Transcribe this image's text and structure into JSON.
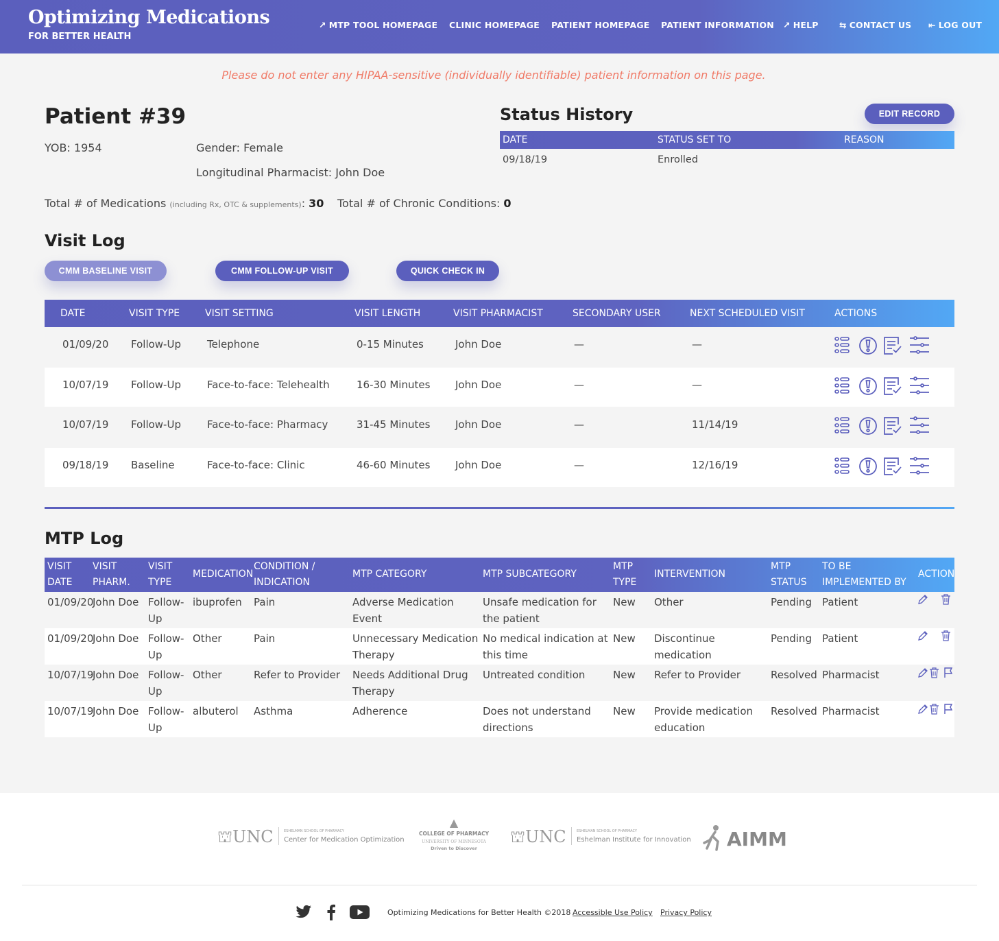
{
  "header": {
    "title": "Optimizing Medications",
    "subtitle": "FOR BETTER HEALTH",
    "nav": [
      {
        "label": "MTP TOOL HOMEPAGE",
        "icon": "arrow-up-right-icon"
      },
      {
        "label": "CLINIC HOMEPAGE"
      },
      {
        "label": "PATIENT HOMEPAGE"
      },
      {
        "label": "PATIENT INFORMATION"
      },
      {
        "label": "HELP",
        "icon": "arrow-up-right-icon"
      },
      {
        "label": "CONTACT US",
        "icon": "swap-arrows-icon"
      },
      {
        "label": "LOG OUT",
        "icon": "logout-icon"
      }
    ]
  },
  "notice": "Please do not enter any HIPAA-sensitive (individually identifiable) patient information on this page.",
  "patient": {
    "title": "Patient #39",
    "yob": "YOB: 1954",
    "gender": "Gender: Female",
    "pharmacist": "Longitudinal Pharmacist: John Doe",
    "meds_label": "Total # of Medications",
    "meds_note": "(including Rx, OTC & supplements)",
    "meds_colon": ":",
    "meds_value": "30",
    "cond_label": "Total # of Chronic Conditions:",
    "cond_value": "0"
  },
  "status_history": {
    "title": "Status History",
    "edit_label": "EDIT RECORD",
    "headers": [
      "DATE",
      "STATUS SET TO",
      "REASON"
    ],
    "rows": [
      {
        "date": "09/18/19",
        "status": "Enrolled",
        "reason": ""
      }
    ]
  },
  "visit_log": {
    "title": "Visit Log",
    "buttons": [
      "CMM BASELINE VISIT",
      "CMM FOLLOW-UP VISIT",
      "QUICK CHECK IN"
    ],
    "headers": [
      "DATE",
      "VISIT TYPE",
      "VISIT SETTING",
      "VISIT LENGTH",
      "VISIT PHARMACIST",
      "SECONDARY USER",
      "NEXT SCHEDULED VISIT",
      "ACTIONS"
    ],
    "rows": [
      {
        "date": "01/09/20",
        "type": "Follow-Up",
        "setting": "Telephone",
        "length": "0-15 Minutes",
        "pharmacist": "John Doe",
        "secondary": "—",
        "next": "—"
      },
      {
        "date": "10/07/19",
        "type": "Follow-Up",
        "setting": "Face-to-face: Telehealth",
        "length": "16-30 Minutes",
        "pharmacist": "John Doe",
        "secondary": "—",
        "next": "—"
      },
      {
        "date": "10/07/19",
        "type": "Follow-Up",
        "setting": "Face-to-face: Pharmacy",
        "length": "31-45 Minutes",
        "pharmacist": "John Doe",
        "secondary": "—",
        "next": "11/14/19"
      },
      {
        "date": "09/18/19",
        "type": "Baseline",
        "setting": "Face-to-face: Clinic",
        "length": "46-60 Minutes",
        "pharmacist": "John Doe",
        "secondary": "—",
        "next": "12/16/19"
      }
    ],
    "action_icons": [
      "list-icon",
      "alert-circle-icon",
      "checklist-icon",
      "sliders-icon"
    ]
  },
  "mtp_log": {
    "title": "MTP Log",
    "headers": [
      {
        "l1": "VISIT",
        "l2": "DATE"
      },
      {
        "l1": "VISIT",
        "l2": "PHARM."
      },
      {
        "l1": "VISIT",
        "l2": "TYPE"
      },
      {
        "l1": "MEDICATION",
        "l2": ""
      },
      {
        "l1": "CONDITION /",
        "l2": "INDICATION"
      },
      {
        "l1": "MTP CATEGORY",
        "l2": ""
      },
      {
        "l1": "MTP SUBCATEGORY",
        "l2": ""
      },
      {
        "l1": "MTP",
        "l2": "TYPE"
      },
      {
        "l1": "INTERVENTION",
        "l2": ""
      },
      {
        "l1": "MTP",
        "l2": "STATUS"
      },
      {
        "l1": "TO BE",
        "l2": "IMPLEMENTED BY"
      },
      {
        "l1": "ACTION",
        "l2": ""
      }
    ],
    "rows": [
      {
        "date": "01/09/20",
        "pharm": "John Doe",
        "type": "Follow-Up",
        "med": "ibuprofen",
        "cond": "Pain",
        "cat": "Adverse Medication Event",
        "sub": "Unsafe medication for the patient",
        "mtype": "New",
        "interv": "Other",
        "status": "Pending",
        "impl": "Patient",
        "actions": [
          "pencil-icon",
          "trash-icon"
        ]
      },
      {
        "date": "01/09/20",
        "pharm": "John Doe",
        "type": "Follow-Up",
        "med": "Other",
        "cond": "Pain",
        "cat": "Unnecessary Medication Therapy",
        "sub": "No medical indication at this time",
        "mtype": "New",
        "interv": "Discontinue medication",
        "status": "Pending",
        "impl": "Patient",
        "actions": [
          "pencil-icon",
          "trash-icon"
        ]
      },
      {
        "date": "10/07/19",
        "pharm": "John Doe",
        "type": "Follow-Up",
        "med": "Other",
        "cond": "Refer to Provider",
        "cat": "Needs Additional Drug Therapy",
        "sub": "Untreated condition",
        "mtype": "New",
        "interv": "Refer to Provider",
        "status": "Resolved",
        "impl": "Pharmacist",
        "actions": [
          "pencil-icon",
          "trash-icon",
          "flag-icon"
        ]
      },
      {
        "date": "10/07/19",
        "pharm": "John Doe",
        "type": "Follow-Up",
        "med": "albuterol",
        "cond": "Asthma",
        "cat": "Adherence",
        "sub": "Does not understand directions",
        "mtype": "New",
        "interv": "Provide medication education",
        "status": "Resolved",
        "impl": "Pharmacist",
        "actions": [
          "pencil-icon",
          "trash-icon",
          "flag-icon"
        ]
      }
    ]
  },
  "footer": {
    "logos": [
      {
        "main": "UNC",
        "small": "ESHELMAN SCHOOL OF PHARMACY",
        "name": "Center for Medication Optimization"
      },
      {
        "top": "COLLEGE OF PHARMACY",
        "mid": "UNIVERSITY OF MINNESOTA",
        "bottom": "Driven to Discover"
      },
      {
        "main": "UNC",
        "small": "ESHELMAN SCHOOL OF PHARMACY",
        "name": "Eshelman Institute for Innovation"
      },
      {
        "main": "AIMM"
      }
    ],
    "social_icons": [
      "twitter-icon",
      "facebook-icon",
      "youtube-icon"
    ],
    "copyright": "Optimizing Medications for Better Health ©2018",
    "links": [
      "Accessible Use Policy",
      "Privacy Policy"
    ]
  },
  "colors": {
    "primary": "#5b5fbd",
    "accent": "#52a8f5",
    "warning": "#f07a67"
  }
}
